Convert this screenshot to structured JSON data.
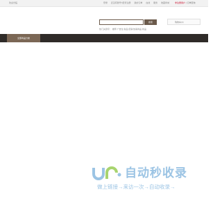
{
  "topbar": {
    "left": "欢迎光临",
    "links": [
      "登录",
      "还没有账号?赶紧注册",
      "我的订单",
      "在线",
      "服务",
      "收藏商城"
    ],
    "right_red": "非注册用户",
    "right_sep": "|",
    "right_grey": "订单查询"
  },
  "search": {
    "button_label": "搜索",
    "hot_words": "热门关键字：  推荐  广告位  新品 促销  热销商品  新品"
  },
  "cart": {
    "label": "购物车(0)"
  },
  "nav": {
    "category_label": "全部商品分类"
  },
  "watermark": {
    "brand": "自动秒收录",
    "slogan": "做上链接→来访一次→自动收录→"
  },
  "colors": {
    "accent_brown": "#6b5a4b",
    "nav_dark": "#2f2b28",
    "nav_tab": "#7b6755",
    "watermark_blue": "#9cc4e4",
    "highlight_red": "#c8102e"
  }
}
